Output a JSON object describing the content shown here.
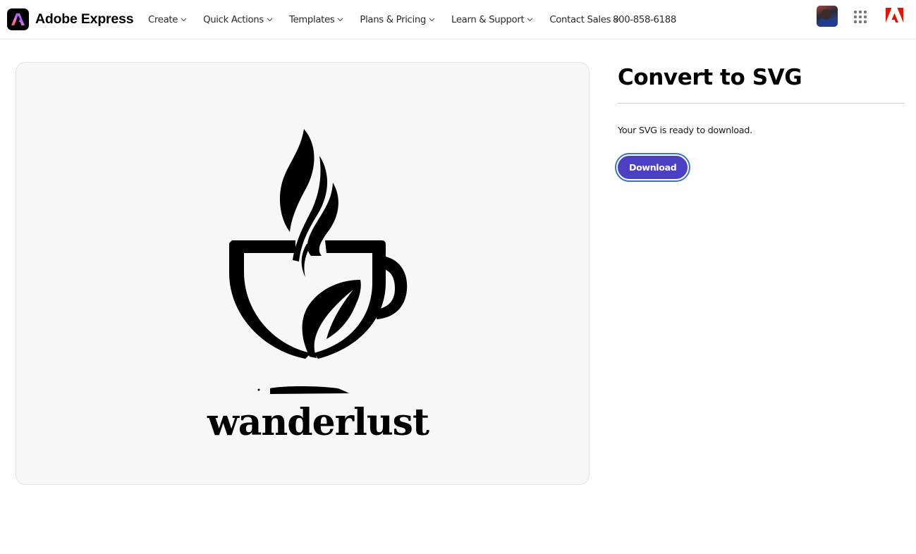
{
  "header": {
    "brand_name": "Adobe Express",
    "nav": [
      {
        "label": "Create"
      },
      {
        "label": "Quick Actions"
      },
      {
        "label": "Templates"
      },
      {
        "label": "Plans & Pricing"
      },
      {
        "label": "Learn & Support"
      },
      {
        "label": "Contact Sales"
      }
    ],
    "phone": "800-858-6188",
    "icons": {
      "brand": "adobe-express-logo-icon",
      "avatar": "user-avatar",
      "apps": "app-grid-icon",
      "adobe": "adobe-logo-icon"
    }
  },
  "preview": {
    "image_text": "wanderlust",
    "image_subject": "coffee cup logo with steam and leaf"
  },
  "panel": {
    "title": "Convert to SVG",
    "status": "Your SVG is ready to download.",
    "download_label": "Download"
  },
  "colors": {
    "accent": "#4b3fc4",
    "focus_ring": "#3a6fd1",
    "adobe_red": "#eb1000",
    "preview_bg": "#f7f7f7"
  }
}
